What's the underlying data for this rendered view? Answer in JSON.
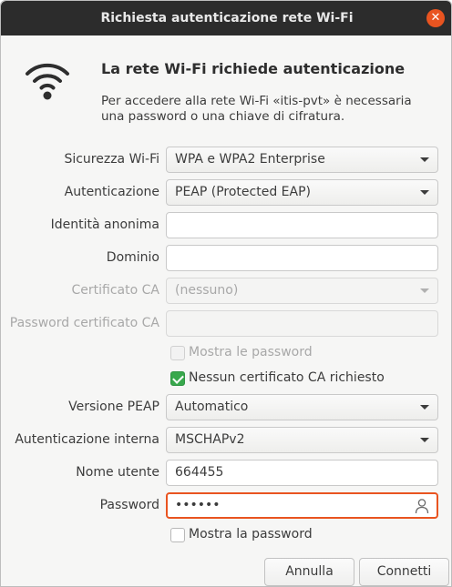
{
  "window": {
    "title": "Richiesta autenticazione rete Wi-Fi"
  },
  "header": {
    "heading": "La rete Wi-Fi richiede autenticazione",
    "description": "Per accedere alla rete Wi-Fi «itis-pvt» è necessaria una password o una chiave di cifratura."
  },
  "form": {
    "security": {
      "label": "Sicurezza Wi-Fi",
      "value": "WPA e WPA2 Enterprise"
    },
    "authentication": {
      "label": "Autenticazione",
      "value": "PEAP (Protected EAP)"
    },
    "anonymous_identity": {
      "label": "Identità anonima",
      "value": ""
    },
    "domain": {
      "label": "Dominio",
      "value": ""
    },
    "ca_certificate": {
      "label": "Certificato CA",
      "value": "(nessuno)"
    },
    "ca_cert_password": {
      "label": "Password certificato CA",
      "value": ""
    },
    "show_passwords": {
      "label": "Mostra le password",
      "checked": false
    },
    "no_ca_required": {
      "label": "Nessun certificato CA richiesto",
      "checked": true
    },
    "peap_version": {
      "label": "Versione PEAP",
      "value": "Automatico"
    },
    "inner_auth": {
      "label": "Autenticazione interna",
      "value": "MSCHAPv2"
    },
    "username": {
      "label": "Nome utente",
      "value": "664455"
    },
    "password": {
      "label": "Password",
      "value": "••••••"
    },
    "show_password": {
      "label": "Mostra la password",
      "checked": false
    }
  },
  "buttons": {
    "cancel": "Annulla",
    "connect": "Connetti"
  },
  "icons": {
    "close": "close-icon",
    "wifi": "wifi-icon",
    "user": "user-icon"
  },
  "colors": {
    "accent": "#e95420",
    "check": "#38a84c",
    "titlebar": "#2c2c2c"
  }
}
